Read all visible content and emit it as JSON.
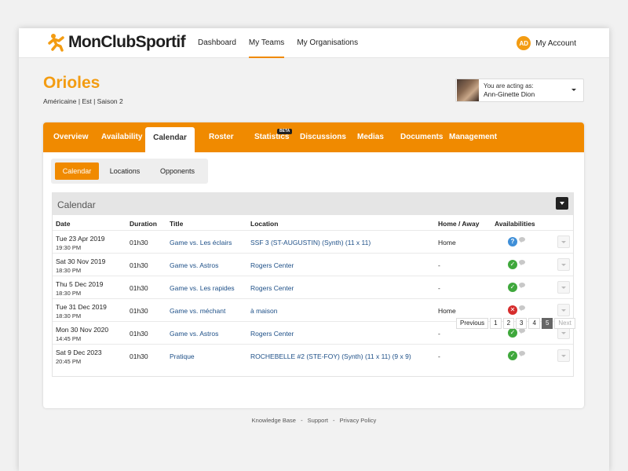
{
  "brand": {
    "name": "MonClubSportif"
  },
  "nav": {
    "items": [
      {
        "label": "Dashboard",
        "active": false
      },
      {
        "label": "My Teams",
        "active": true
      },
      {
        "label": "My Organisations",
        "active": false
      }
    ]
  },
  "account": {
    "initials": "AD",
    "label": "My Account"
  },
  "team": {
    "name": "Orioles",
    "subtitle": "Américaine | Est | Saison 2"
  },
  "acting": {
    "label": "You are acting as:",
    "name": "Ann-Ginette Dion"
  },
  "tabs": [
    {
      "label": "Overview"
    },
    {
      "label": "Availability"
    },
    {
      "label": "Calendar",
      "active": true
    },
    {
      "label": "Roster"
    },
    {
      "label": "Statistics",
      "badge": "BETA"
    },
    {
      "label": "Discussions"
    },
    {
      "label": "Medias"
    },
    {
      "label": "Documents"
    },
    {
      "label": "Management"
    }
  ],
  "subtabs": [
    {
      "label": "Calendar",
      "active": true
    },
    {
      "label": "Locations"
    },
    {
      "label": "Opponents"
    }
  ],
  "calendar": {
    "title": "Calendar",
    "columns": [
      "Date",
      "Duration",
      "Title",
      "Location",
      "Home / Away",
      "Availabilities"
    ],
    "rows": [
      {
        "date": "Tue 23 Apr 2019",
        "time": "19:30 PM",
        "duration": "01h30",
        "title": "Game vs. Les éclairs",
        "location": "SSF 3 (ST-AUGUSTIN) (Synth) (11 x 11)",
        "home_away": "Home",
        "availability": "unknown"
      },
      {
        "date": "Sat 30 Nov 2019",
        "time": "18:30 PM",
        "duration": "01h30",
        "title": "Game vs. Astros",
        "location": "Rogers Center",
        "home_away": "-",
        "availability": "available"
      },
      {
        "date": "Thu 5 Dec 2019",
        "time": "18:30 PM",
        "duration": "01h30",
        "title": "Game vs. Les rapides",
        "location": "Rogers Center",
        "home_away": "-",
        "availability": "available"
      },
      {
        "date": "Tue 31 Dec 2019",
        "time": "18:30 PM",
        "duration": "01h30",
        "title": "Game vs. méchant",
        "location": "à maison",
        "home_away": "Home",
        "availability": "unavailable"
      },
      {
        "date": "Mon 30 Nov 2020",
        "time": "14:45 PM",
        "duration": "01h30",
        "title": "Game vs. Astros",
        "location": "Rogers Center",
        "home_away": "-",
        "availability": "available"
      },
      {
        "date": "Sat 9 Dec 2023",
        "time": "20:45 PM",
        "duration": "01h30",
        "title": "Pratique",
        "location": "ROCHEBELLE #2 (STE-FOY) (Synth) (11 x 11) (9 x 9)",
        "home_away": "-",
        "availability": "available"
      }
    ]
  },
  "pagination": {
    "prev": "Previous",
    "pages": [
      "1",
      "2",
      "3",
      "4",
      "5"
    ],
    "current": "5",
    "next": "Next"
  },
  "footer": {
    "links": [
      "Knowledge Base",
      "Support",
      "Privacy Policy"
    ],
    "separator": "-"
  },
  "colors": {
    "brand_orange": "#f08a00",
    "title_orange": "#f39c12",
    "link_blue": "#1d4f87",
    "available_green": "#3fa83c",
    "unknown_blue": "#3f8fd8",
    "unavailable_red": "#d62c2c"
  }
}
